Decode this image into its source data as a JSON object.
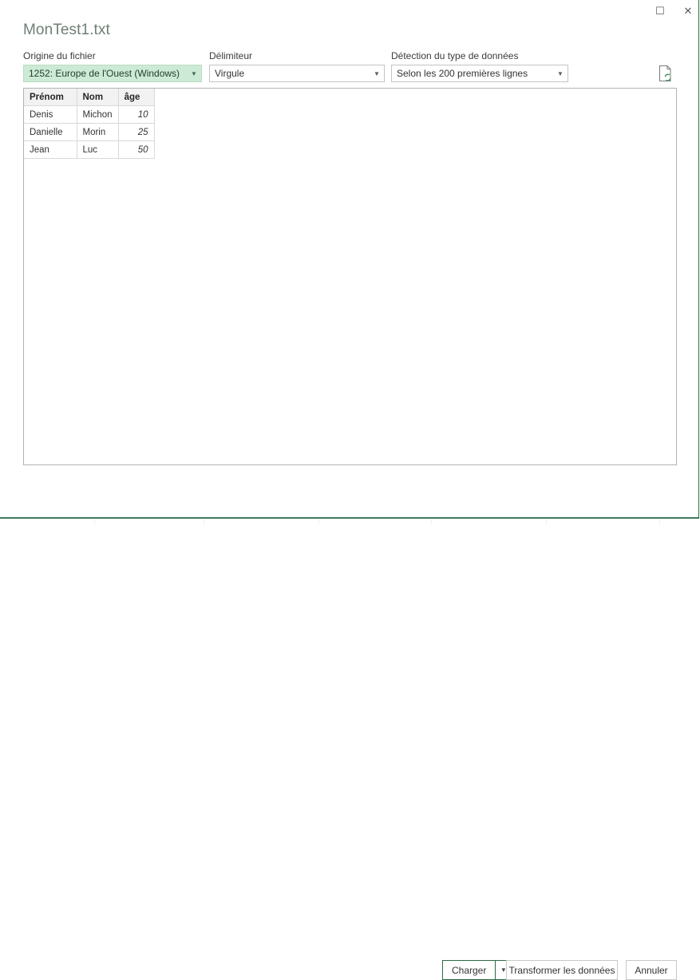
{
  "window": {
    "title": "MonTest1.txt",
    "controls": [
      {
        "name": "maximize",
        "glyph": "☐"
      },
      {
        "name": "close",
        "glyph": "✕"
      }
    ]
  },
  "options": {
    "file_origin": {
      "label": "Origine du fichier",
      "value": "1252: Europe de l'Ouest (Windows)",
      "arrow": "▼"
    },
    "delimiter": {
      "label": "Délimiteur",
      "value": "Virgule",
      "arrow": "▼"
    },
    "type_detection": {
      "label": "Détection du type de données",
      "value": "Selon les 200 premières lignes",
      "arrow": "▼"
    }
  },
  "icons": {
    "refresh_document": "document-refresh-icon"
  },
  "preview": {
    "columns": [
      "Prénom",
      "Nom",
      "âge"
    ],
    "rows": [
      [
        "Denis",
        "Michon",
        "10"
      ],
      [
        "Danielle",
        "Morin",
        "25"
      ],
      [
        "Jean",
        "Luc",
        "50"
      ]
    ]
  },
  "footer": {
    "load_label": "Charger",
    "load_arrow": "▼",
    "transform_label": "Transformer les données",
    "cancel_label": "Annuler"
  },
  "colors": {
    "excel_green": "#217346",
    "highlight_mint": "#cdead7",
    "title_gray": "#6e7f75",
    "panel_border": "#b3b3b3"
  }
}
